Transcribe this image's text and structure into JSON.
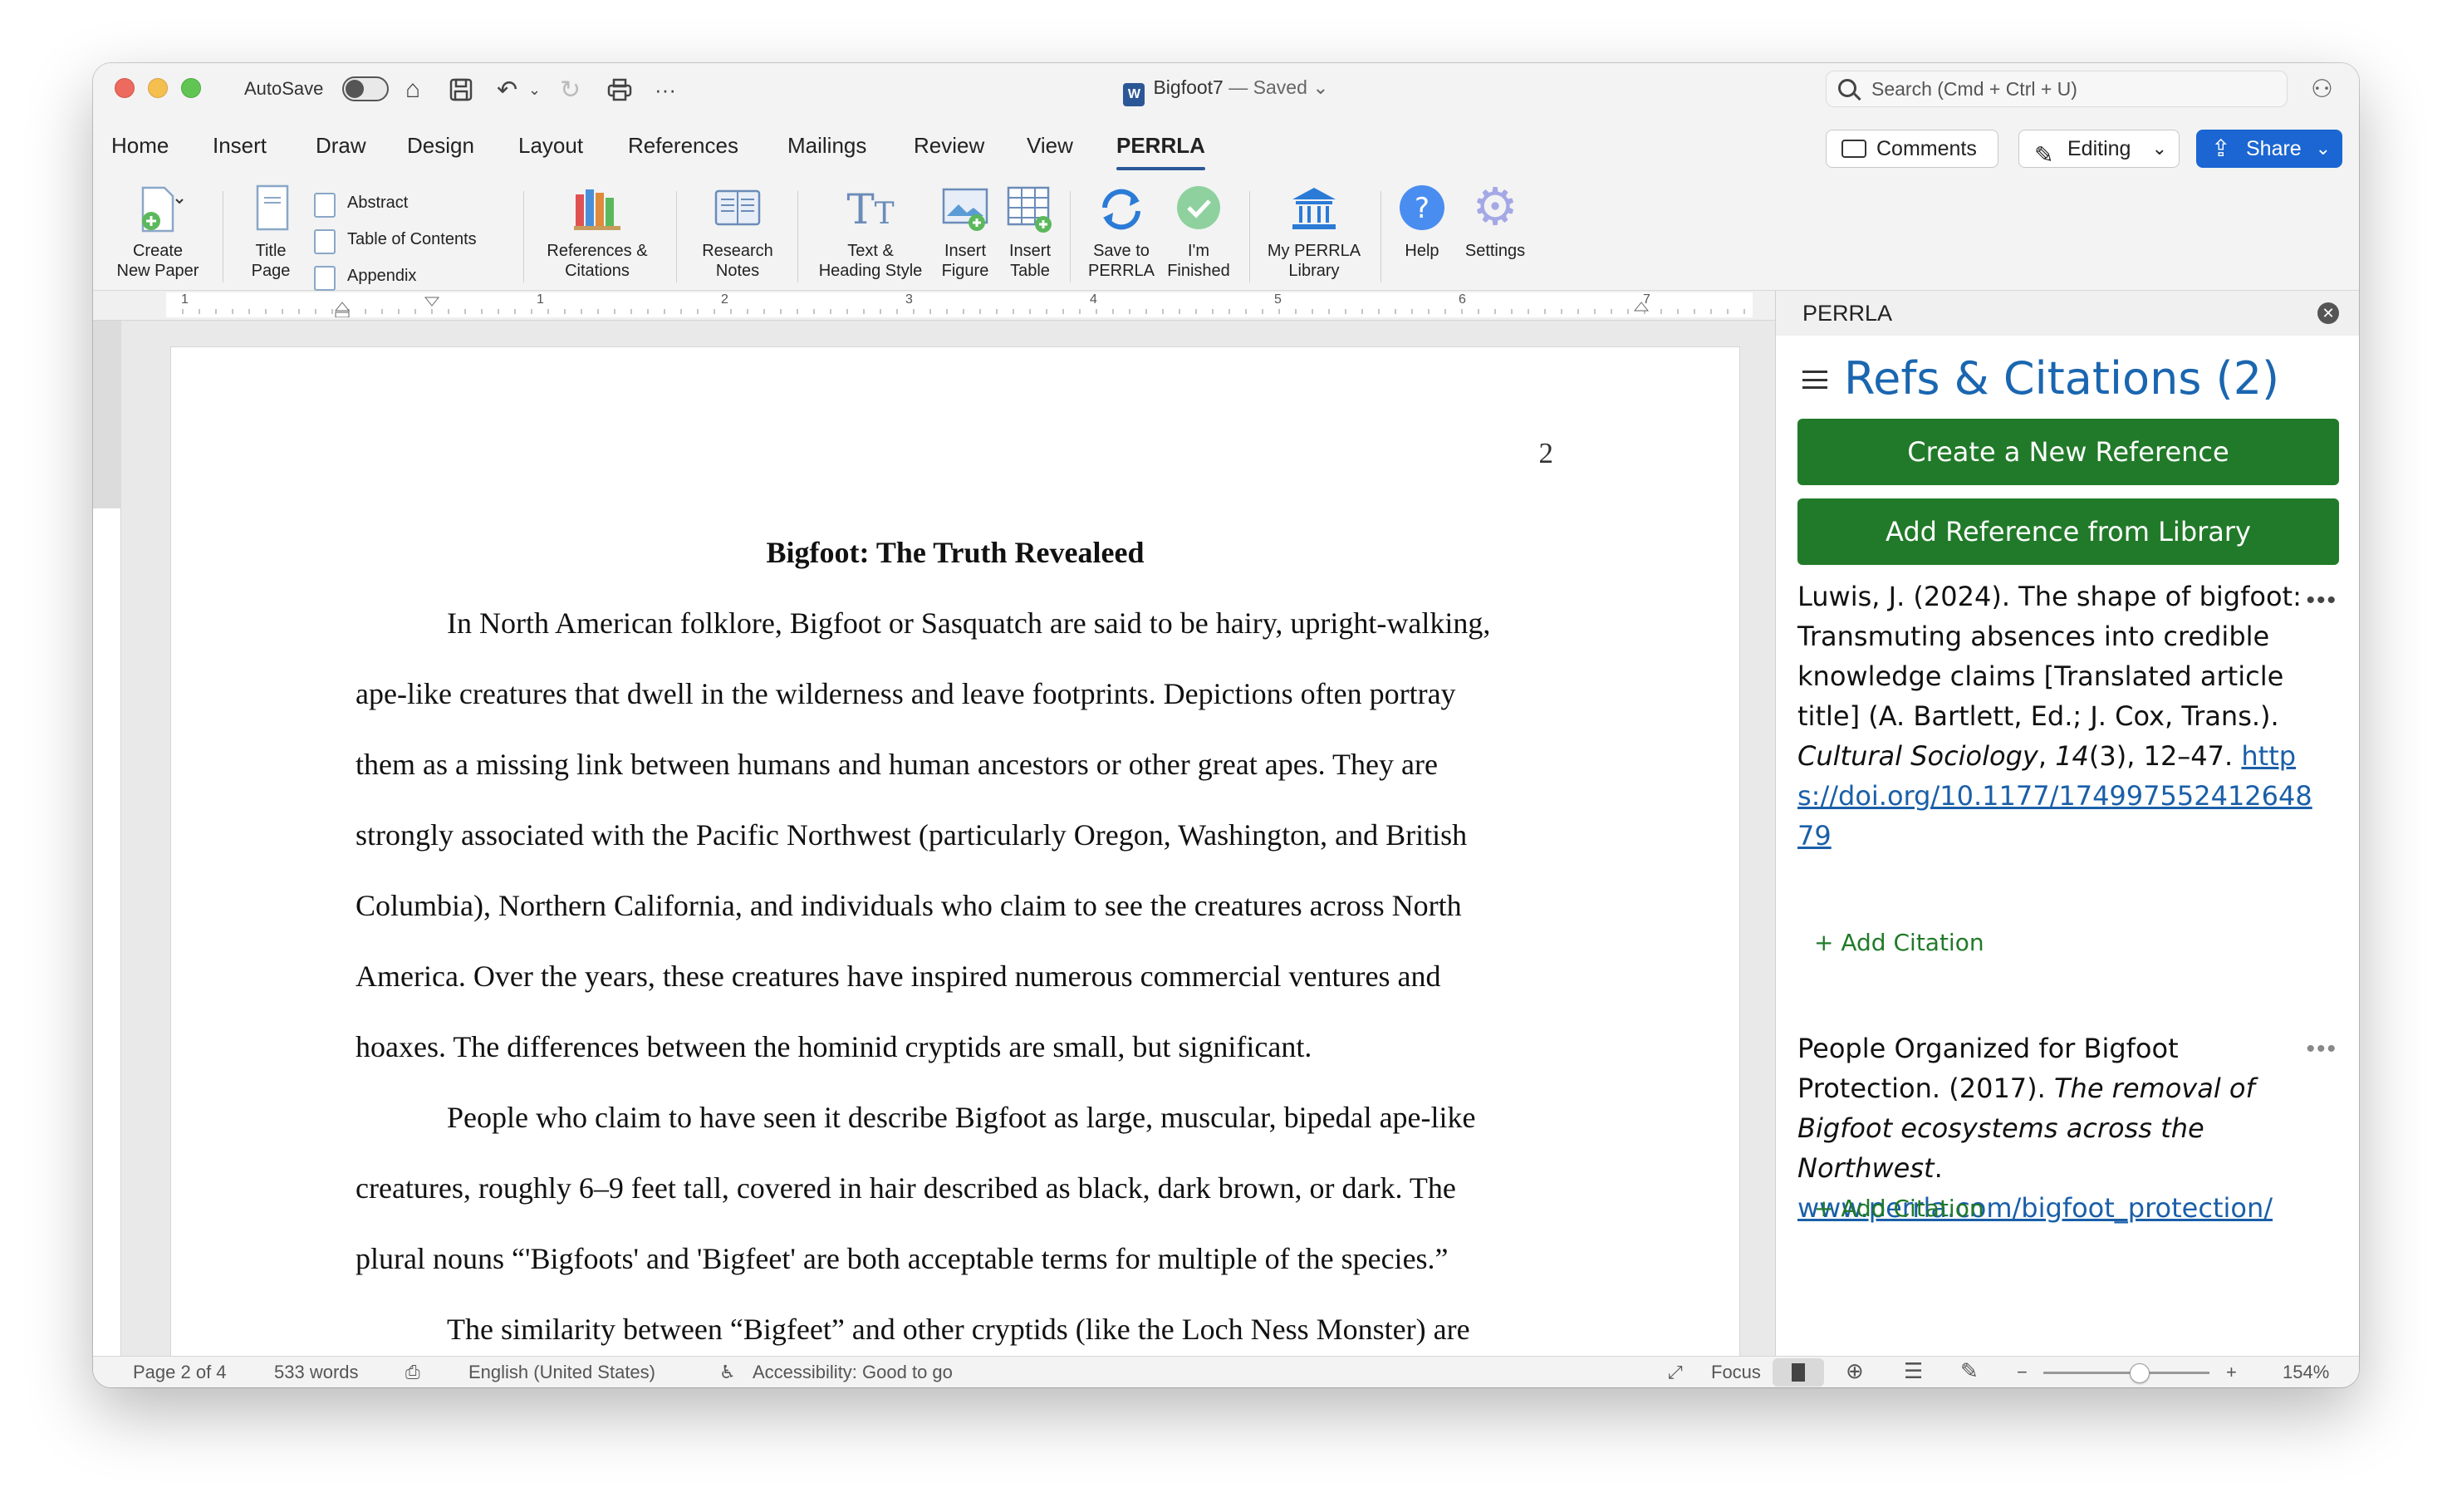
{
  "titlebar": {
    "autosave_label": "AutoSave",
    "doc_name": "Bigfoot7",
    "doc_status": " — Saved",
    "search_placeholder": "Search (Cmd + Ctrl + U)"
  },
  "menu": {
    "tabs": [
      "Home",
      "Insert",
      "Draw",
      "Design",
      "Layout",
      "References",
      "Mailings",
      "Review",
      "View",
      "PERRLA"
    ],
    "active_tab": "PERRLA",
    "comments_label": "Comments",
    "editing_label": "Editing",
    "share_label": "Share"
  },
  "ribbon": {
    "create_new_paper": [
      "Create",
      "New Paper"
    ],
    "title_page": [
      "Title",
      "Page"
    ],
    "abstract": "Abstract",
    "toc": "Table of Contents",
    "appendix": "Appendix",
    "refs_citations": [
      "References &",
      "Citations"
    ],
    "research_notes": [
      "Research",
      "Notes"
    ],
    "text_heading": [
      "Text &",
      "Heading Style"
    ],
    "insert_figure": [
      "Insert",
      "Figure"
    ],
    "insert_table": [
      "Insert",
      "Table"
    ],
    "save_to": [
      "Save to",
      "PERRLA"
    ],
    "finished": [
      "I'm",
      "Finished"
    ],
    "library": [
      "My PERRLA",
      "Library"
    ],
    "help": "Help",
    "settings": "Settings"
  },
  "ruler": {
    "numbers": [
      "1",
      "1",
      "2",
      "3",
      "4",
      "5",
      "6",
      "7"
    ]
  },
  "document": {
    "page_number": "2",
    "title": "Bigfoot: The Truth Revealeed",
    "lines": [
      "In North American folklore, Bigfoot or Sasquatch are said to be hairy, upright-walking,",
      "ape-like creatures that dwell in the wilderness and leave footprints. Depictions often portray",
      "them as a missing link between humans and human ancestors or other great apes. They are",
      "strongly associated with the Pacific Northwest (particularly Oregon, Washington, and British",
      "Columbia), Northern California, and individuals who claim to see the creatures across North",
      "America. Over the years, these creatures have inspired numerous commercial ventures and",
      "hoaxes. The differences between the hominid cryptids are small, but significant.",
      "People who claim to have seen it describe Bigfoot as large, muscular, bipedal ape-like",
      "creatures, roughly 6–9 feet tall, covered in hair described as black, dark brown, or dark. The",
      "plural nouns “'Bigfoots' and 'Bigfeet' are both acceptable terms for multiple of the species.”",
      "The similarity between “Bigfeet” and other cryptids (like the Loch Ness Monster) are"
    ]
  },
  "pane": {
    "header": "PERRLA",
    "title": "Refs & Citations",
    "count": "(2)",
    "create_btn": "Create a New Reference",
    "library_btn": "Add Reference from Library",
    "refs": [
      {
        "text_plain": "Luwis, J. (2024). The shape of bigfoot: Transmuting absences into credible knowledge claims [Translated article title] (A. Bartlett, Ed.; J. Cox, Trans.). ",
        "italic": "Cultural Sociology",
        "after_italic": ", ",
        "volume": "14",
        "issue_pages": "(3), 12–47.",
        "link": "https://doi.org/10.1177/17499755241264879",
        "add_citation": "Add Citation"
      },
      {
        "text_plain": "People Organized for Bigfoot Protection. (2017). ",
        "italic": "The removal of Bigfoot ecosystems across the Northwest",
        "after_italic": ".",
        "link": "www.perrla.com/bigfoot_protection/",
        "add_citation": "Add Citation"
      }
    ]
  },
  "status": {
    "page": "Page 2 of 4",
    "words": "533 words",
    "language": "English (United States)",
    "accessibility": "Accessibility: Good to go",
    "focus": "Focus",
    "zoom": "154%"
  }
}
